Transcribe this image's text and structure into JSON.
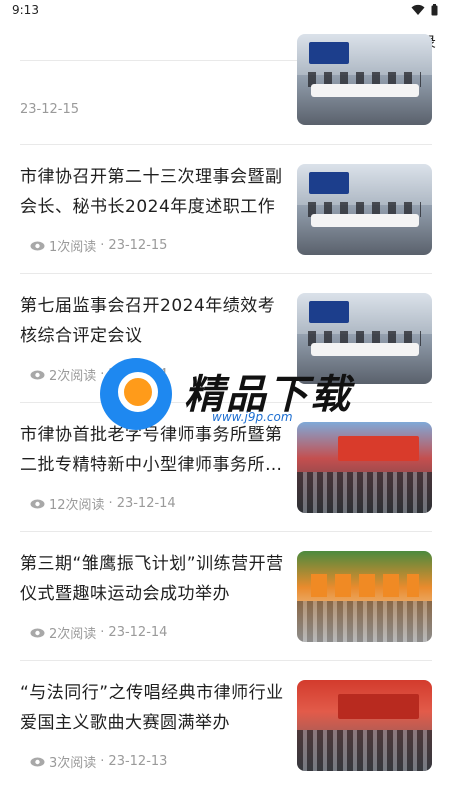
{
  "status_bar": {
    "time": "9:13"
  },
  "header": {
    "login_label": "登录"
  },
  "watermark": {
    "title": "精品下载",
    "url": "www.j9p.com"
  },
  "articles": [
    {
      "title": "",
      "reads": "",
      "date": "23-12-15",
      "image": "meeting-room-photo"
    },
    {
      "title": "市律协召开第二十三次理事会暨副会长、秘书长2024年度述职工作",
      "reads": "1次阅读",
      "sep": "·",
      "date": "23-12-15",
      "image": "meeting-room-photo"
    },
    {
      "title": "第七届监事会召开2024年绩效考核综合评定会议",
      "reads": "2次阅读",
      "sep": "·",
      "date": "23-12-14",
      "image": "meeting-room-photo"
    },
    {
      "title": "市律协首批老字号律师事务所暨第二批专精特新中小型律师事务所…",
      "reads": "12次阅读",
      "sep": "·",
      "date": "23-12-14",
      "image": "conference-hall-photo"
    },
    {
      "title": "第三期“雏鹰振飞计划”训练营开营仪式暨趣味运动会成功举办",
      "reads": "2次阅读",
      "sep": "·",
      "date": "23-12-14",
      "image": "outdoor-group-photo"
    },
    {
      "title": "“与法同行”之传唱经典市律师行业爱国主义歌曲大赛圆满举办",
      "reads": "3次阅读",
      "sep": "·",
      "date": "23-12-13",
      "image": "stage-performance-photo"
    }
  ]
}
